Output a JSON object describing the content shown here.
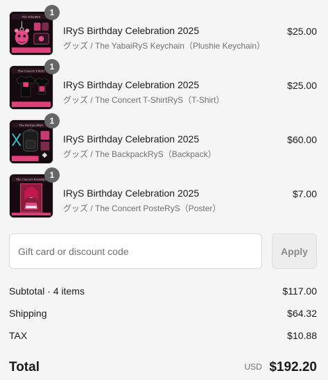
{
  "cart": {
    "items": [
      {
        "quantity": "1",
        "title": "IRyS Birthday Celebration 2025",
        "variant": "グッズ / The YabaiRyS Keychain（Plushie Keychain）",
        "price": "$25.00",
        "thumbnail": "keychain-thumbnail"
      },
      {
        "quantity": "1",
        "title": "IRyS Birthday Celebration 2025",
        "variant": "グッズ / The Concert T-ShirtRyS（T-Shirt）",
        "price": "$25.00",
        "thumbnail": "t-shirt-thumbnail"
      },
      {
        "quantity": "1",
        "title": "IRyS Birthday Celebration 2025",
        "variant": "グッズ / The BackpackRyS（Backpack）",
        "price": "$60.00",
        "thumbnail": "backpack-thumbnail"
      },
      {
        "quantity": "1",
        "title": "IRyS Birthday Celebration 2025",
        "variant": "グッズ / The Concert PosteRyS（Poster）",
        "price": "$7.00",
        "thumbnail": "poster-thumbnail"
      }
    ]
  },
  "discount": {
    "placeholder": "Gift card or discount code",
    "value": "",
    "apply_label": "Apply"
  },
  "summary": {
    "subtotal_label": "Subtotal · 4 items",
    "subtotal_value": "$117.00",
    "shipping_label": "Shipping",
    "shipping_value": "$64.32",
    "tax_label": "TAX",
    "tax_value": "$10.88",
    "total_label": "Total",
    "currency": "USD",
    "total_value": "$192.20"
  },
  "colors": {
    "background": "#f5f5f5",
    "badge": "#666666",
    "muted_text": "#707070",
    "apply_button_bg": "#ededed",
    "thumbnail_accent": "#e0407a"
  }
}
